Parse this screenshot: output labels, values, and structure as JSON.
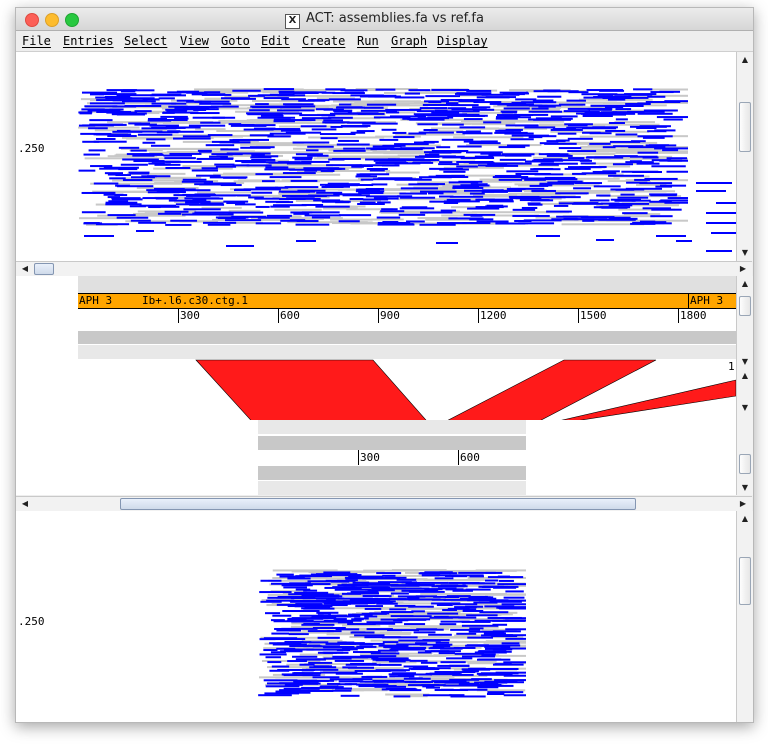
{
  "window": {
    "title": "ACT: assemblies.fa vs ref.fa"
  },
  "menu": {
    "items": [
      "File",
      "Entries",
      "Select",
      "View",
      "Goto",
      "Edit",
      "Create",
      "Run",
      "Graph",
      "Display"
    ]
  },
  "top_plot": {
    "ylabel": ".250"
  },
  "bottom_plot": {
    "ylabel": ".250"
  },
  "ref_track": {
    "feature_label_1": "APH 3",
    "feature_label_2": "Ib+.l6.c30.ctg.1",
    "feature_label_3": "APH 3",
    "ticks": [
      "300",
      "600",
      "900",
      "1200",
      "1500",
      "1800"
    ],
    "right_marker": "1"
  },
  "query_track": {
    "ticks": [
      "300",
      "600"
    ]
  },
  "colors": {
    "feature": "#ffa500",
    "comparison": "#ff1a1a",
    "read": "#0000ff",
    "read_grey": "#c8c8c8"
  }
}
